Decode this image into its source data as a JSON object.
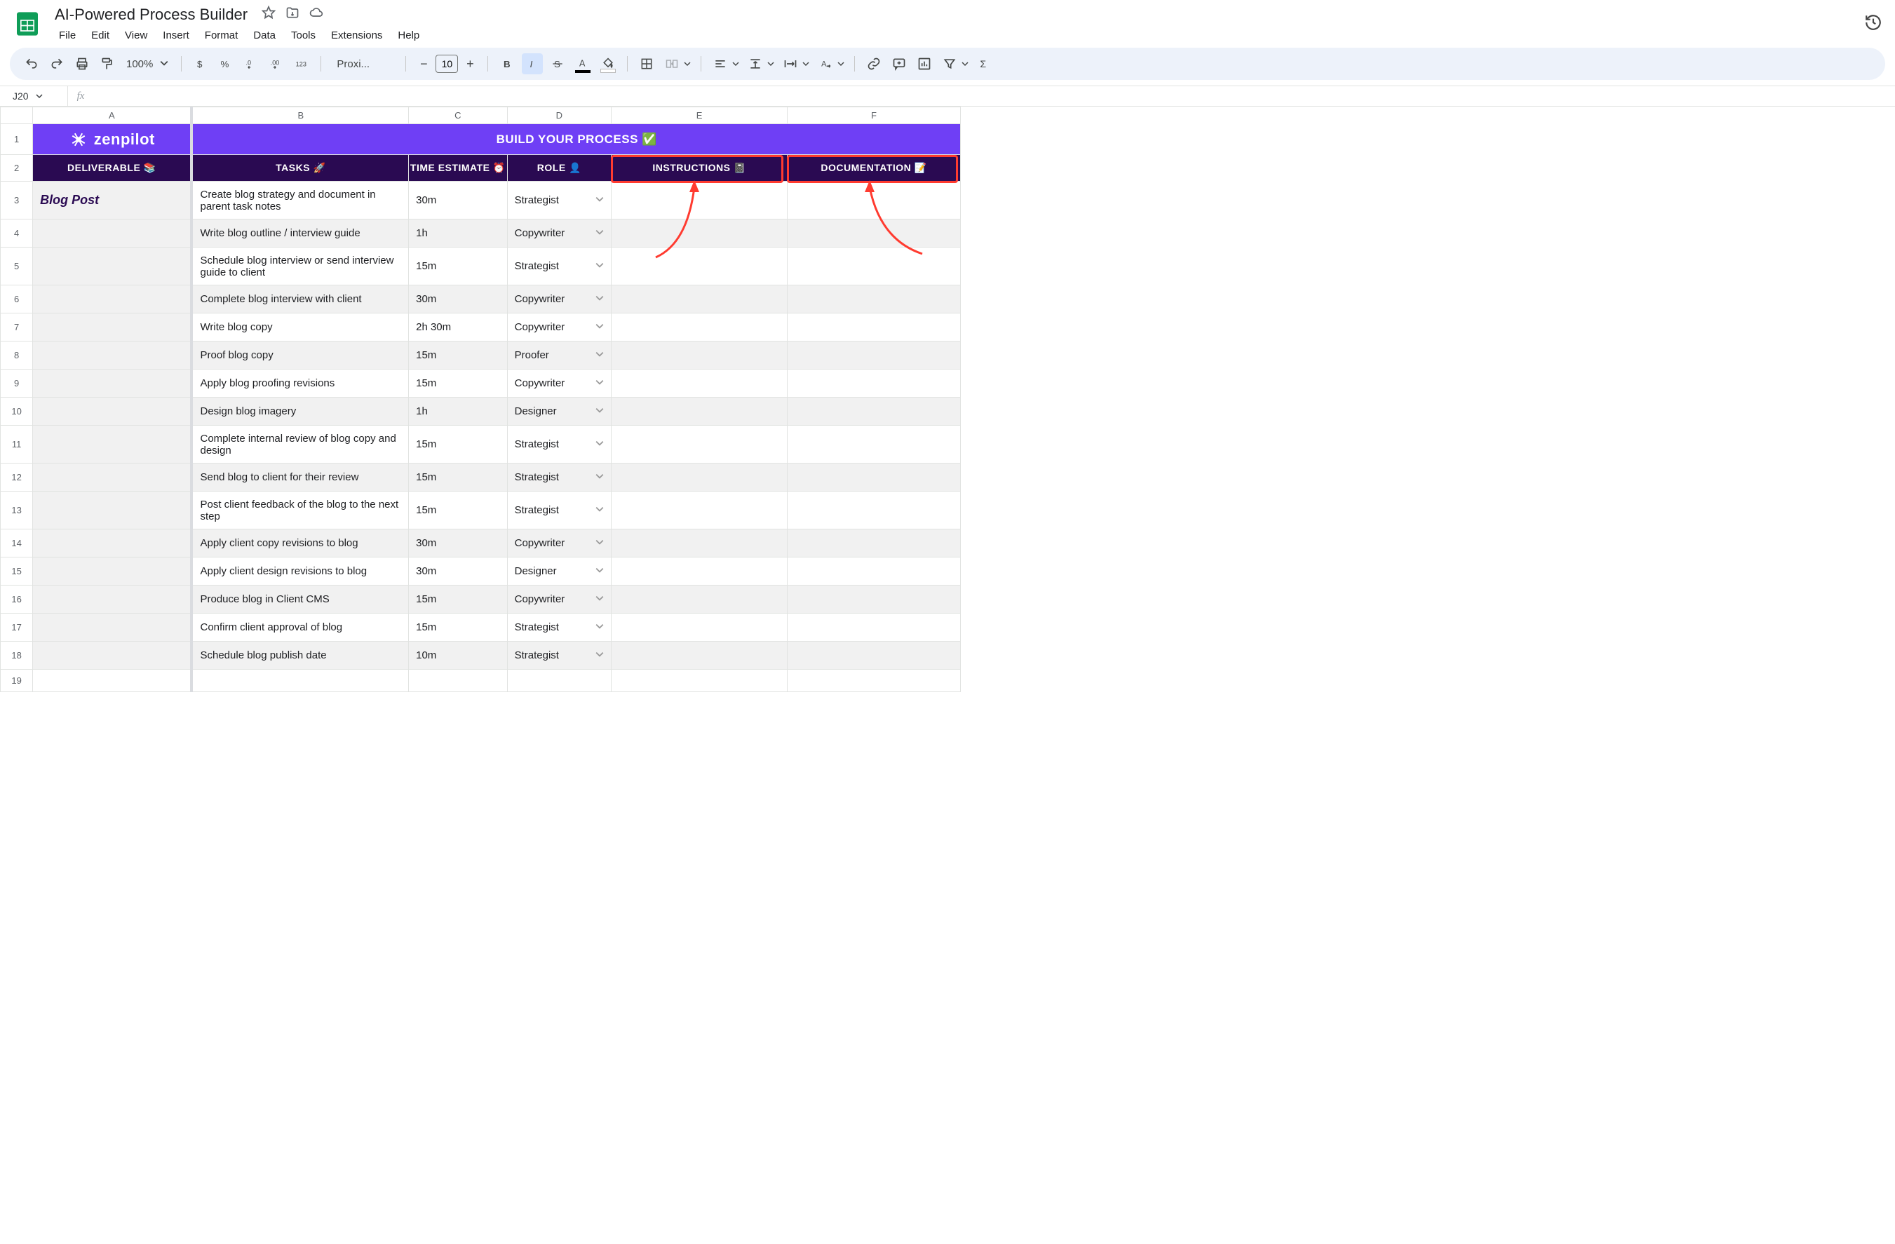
{
  "doc": {
    "title": "AI-Powered Process Builder"
  },
  "menubar": [
    "File",
    "Edit",
    "View",
    "Insert",
    "Format",
    "Data",
    "Tools",
    "Extensions",
    "Help"
  ],
  "toolbar": {
    "zoom": "100%",
    "font": "Proxi...",
    "fontSize": "10"
  },
  "nameBox": "J20",
  "formula": "",
  "columns": [
    "A",
    "B",
    "C",
    "D",
    "E",
    "F"
  ],
  "banner": {
    "logo": "zenpilot",
    "title": "BUILD YOUR PROCESS ✅"
  },
  "headers": {
    "A": "DELIVERABLE 📚",
    "B": "TASKS 🚀",
    "C": "TIME ESTIMATE ⏰",
    "D": "ROLE 👤",
    "E": "INSTRUCTIONS 📓",
    "F": "DOCUMENTATION 📝"
  },
  "rows": [
    {
      "n": 3,
      "deliverable": "Blog Post",
      "task": "Create blog strategy and document in parent task notes",
      "time": "30m",
      "role": "Strategist",
      "tall": true
    },
    {
      "n": 4,
      "task": "Write blog outline / interview guide",
      "time": "1h",
      "role": "Copywriter",
      "alt": true
    },
    {
      "n": 5,
      "task": "Schedule blog interview or send interview guide to client",
      "time": "15m",
      "role": "Strategist",
      "tall": true
    },
    {
      "n": 6,
      "task": "Complete blog interview with client",
      "time": "30m",
      "role": "Copywriter",
      "alt": true
    },
    {
      "n": 7,
      "task": "Write blog copy",
      "time": "2h 30m",
      "role": "Copywriter"
    },
    {
      "n": 8,
      "task": "Proof blog copy",
      "time": "15m",
      "role": "Proofer",
      "alt": true
    },
    {
      "n": 9,
      "task": "Apply blog proofing revisions",
      "time": "15m",
      "role": "Copywriter"
    },
    {
      "n": 10,
      "task": "Design blog imagery",
      "time": "1h",
      "role": "Designer",
      "alt": true
    },
    {
      "n": 11,
      "task": "Complete internal review of blog copy and design",
      "time": "15m",
      "role": "Strategist",
      "tall": true
    },
    {
      "n": 12,
      "task": "Send blog to client for their review",
      "time": "15m",
      "role": "Strategist",
      "alt": true
    },
    {
      "n": 13,
      "task": "Post client feedback of the blog to the next step",
      "time": "15m",
      "role": "Strategist",
      "tall": true
    },
    {
      "n": 14,
      "task": "Apply client copy revisions to blog",
      "time": "30m",
      "role": "Copywriter",
      "alt": true
    },
    {
      "n": 15,
      "task": "Apply client design revisions to blog",
      "time": "30m",
      "role": "Designer"
    },
    {
      "n": 16,
      "task": "Produce blog in Client CMS",
      "time": "15m",
      "role": "Copywriter",
      "alt": true
    },
    {
      "n": 17,
      "task": "Confirm client approval of blog",
      "time": "15m",
      "role": "Strategist"
    },
    {
      "n": 18,
      "task": "Schedule blog publish date",
      "time": "10m",
      "role": "Strategist",
      "alt": true
    },
    {
      "n": 19,
      "empty": true
    }
  ]
}
